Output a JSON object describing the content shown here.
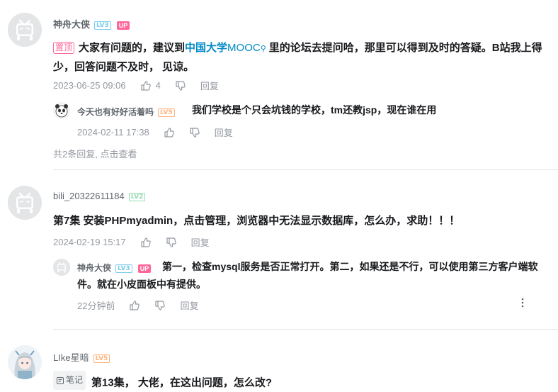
{
  "comments": [
    {
      "user": "神舟大侠",
      "level": "LV3",
      "up_badge": "UP",
      "pinned_label": "置顶",
      "text_before": "大家有问题的，建议到",
      "link_text": "中国大学",
      "link_text2": "MOOC",
      "text_after": "里的论坛去提问哈，那里可以得到及时的答疑。B站我上得少，回答问题不及时， 见谅。",
      "time": "2023-06-25 09:06",
      "likes": "4",
      "reply_label": "回复",
      "replies": [
        {
          "user": "今天也有好好活着吗",
          "level": "LV5",
          "text": "我们学校是个只会坑钱的学校，tm还教jsp，现在谁在用",
          "time": "2024-02-11 17:38",
          "reply_label": "回复"
        }
      ],
      "more_replies": "共2条回复, 点击查看"
    },
    {
      "user": "bili_20322611184",
      "level": "LV2",
      "text": "第7集 安装PHPmyadmin，点击管理，浏览器中无法显示数据库，怎么办，求助！！！",
      "time": "2024-02-19 15:17",
      "reply_label": "回复",
      "replies": [
        {
          "user": "神舟大侠",
          "level": "LV3",
          "up_badge": "UP",
          "text": "第一，检查mysql服务是否正常打开。第二，如果还是不行，可以使用第三方客户端软件。就在小皮面板中有提供。",
          "time": "22分钟前",
          "reply_label": "回复"
        }
      ]
    },
    {
      "user": "LIke星暗",
      "level": "LV5",
      "note_label": "笔记",
      "text": "第13集， 大佬，在这出问题，怎么改?"
    }
  ],
  "icons": {
    "like": "thumb-up-icon",
    "dislike": "thumb-down-icon",
    "more": "more-vertical-icon",
    "note": "note-icon"
  },
  "colors": {
    "accent_pink": "#ff6699",
    "link_blue": "#008ac5",
    "meta_gray": "#9499a0"
  }
}
